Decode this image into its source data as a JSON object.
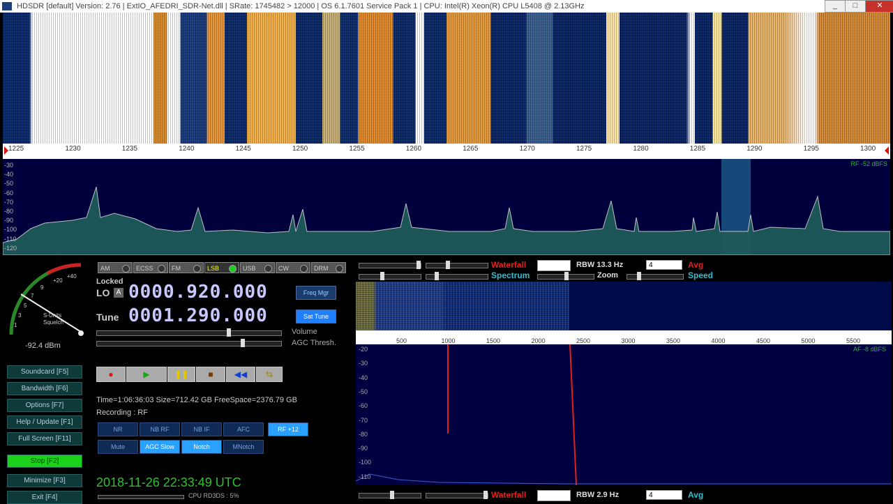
{
  "window": {
    "title": "HDSDR  [default]  Version: 2.76   |   ExtIO_AFEDRI_SDR-Net.dll  |  SRate: 1745482 > 12000   |   OS 6.1.7601  Service Pack 1   |   CPU: Intel(R) Xeon(R) CPU      L5408  @ 2.13GHz",
    "min": "_",
    "max": "□",
    "close": "✕"
  },
  "freq_scale": {
    "ticks": [
      "1225",
      "1230",
      "1235",
      "1240",
      "1245",
      "1250",
      "1255",
      "1260",
      "1265",
      "1270",
      "1275",
      "1280",
      "1285",
      "1290",
      "1295",
      "1300"
    ]
  },
  "spectrum": {
    "db_ticks": [
      "-30",
      "-40",
      "-50",
      "-60",
      "-70",
      "-80",
      "-90",
      "-100",
      "-110",
      "-120"
    ],
    "rf_label": "RF -52 dBFS"
  },
  "smeter": {
    "scale_labels": [
      "+40",
      "+20",
      "9",
      "7",
      "5",
      "3",
      "1"
    ],
    "caption_top": "S-Units",
    "caption_bottom": "Squelch",
    "reading": "-92.4 dBm"
  },
  "sidebar": [
    {
      "label": "Soundcard  [F5]",
      "active": false
    },
    {
      "label": "Bandwidth  [F6]",
      "active": false
    },
    {
      "label": "Options  [F7]",
      "active": false
    },
    {
      "label": "Help / Update  [F1]",
      "active": false
    },
    {
      "label": "Full Screen  [F11]",
      "active": false
    },
    {
      "label": "Stop  [F2]",
      "active": true
    },
    {
      "label": "Minimize  [F3]",
      "active": false
    },
    {
      "label": "Exit  [F4]",
      "active": false
    }
  ],
  "modes": [
    {
      "label": "AM",
      "on": false
    },
    {
      "label": "ECSS",
      "on": false
    },
    {
      "label": "FM",
      "on": false
    },
    {
      "label": "LSB",
      "on": true
    },
    {
      "label": "USB",
      "on": false
    },
    {
      "label": "CW",
      "on": false
    },
    {
      "label": "DRM",
      "on": false
    }
  ],
  "lo": {
    "locked": "Locked",
    "label": "LO",
    "badge": "A",
    "value": "0000.920.000",
    "button": "Freq Mgr"
  },
  "tune": {
    "label": "Tune",
    "value": "0001.290.000",
    "button": "Sat Tune"
  },
  "sliders": {
    "volume": "Volume",
    "agc": "AGC Thresh.",
    "volume_level": 0.72,
    "agc_level": 0.8
  },
  "transport": [
    "●",
    "▶",
    "❚❚",
    "■",
    "◀◀",
    "⇆"
  ],
  "recording": {
    "stats": "Time=1:06:36:03   Size=712.42 GB   FreeSpace=2376.79 GB",
    "status": "Recording : RF"
  },
  "options_row1": [
    {
      "label": "NR",
      "on": false
    },
    {
      "label": "NB RF",
      "on": false
    },
    {
      "label": "NB IF",
      "on": false
    },
    {
      "label": "AFC",
      "on": false
    },
    {
      "label": "RF +12",
      "on": true
    }
  ],
  "options_row2": [
    {
      "label": "Mute",
      "on": false
    },
    {
      "label": "AGC Slow",
      "on": true
    },
    {
      "label": "Notch",
      "on": true
    },
    {
      "label": "MNotch",
      "on": false
    }
  ],
  "status": {
    "clock": "2018-11-26    22:33:49 UTC",
    "cpu": "CPU  RD3DS :  5%"
  },
  "rf_controls": {
    "waterfall": "Waterfall",
    "spectrum": "Spectrum",
    "zoom": "Zoom",
    "speed": "Speed",
    "avg": "Avg",
    "rbw": "RBW  13.3 Hz",
    "avg_value": "4"
  },
  "af_panel": {
    "scale_ticks": [
      "500",
      "1000",
      "1500",
      "2000",
      "2500",
      "3000",
      "3500",
      "4000",
      "4500",
      "5000",
      "5500"
    ],
    "db_ticks": [
      "-20",
      "-30",
      "-40",
      "-50",
      "-60",
      "-70",
      "-80",
      "-90",
      "-100",
      "-110"
    ],
    "af_label": "AF -8 dBFS"
  },
  "af_controls": {
    "waterfall": "Waterfall",
    "avg": "Avg",
    "rbw": "RBW  2.9 Hz",
    "avg_value": "4"
  },
  "colors": {
    "accent_green": "#1bd11b",
    "accent_red": "#e02020",
    "accent_cyan": "#2cc0d0"
  }
}
